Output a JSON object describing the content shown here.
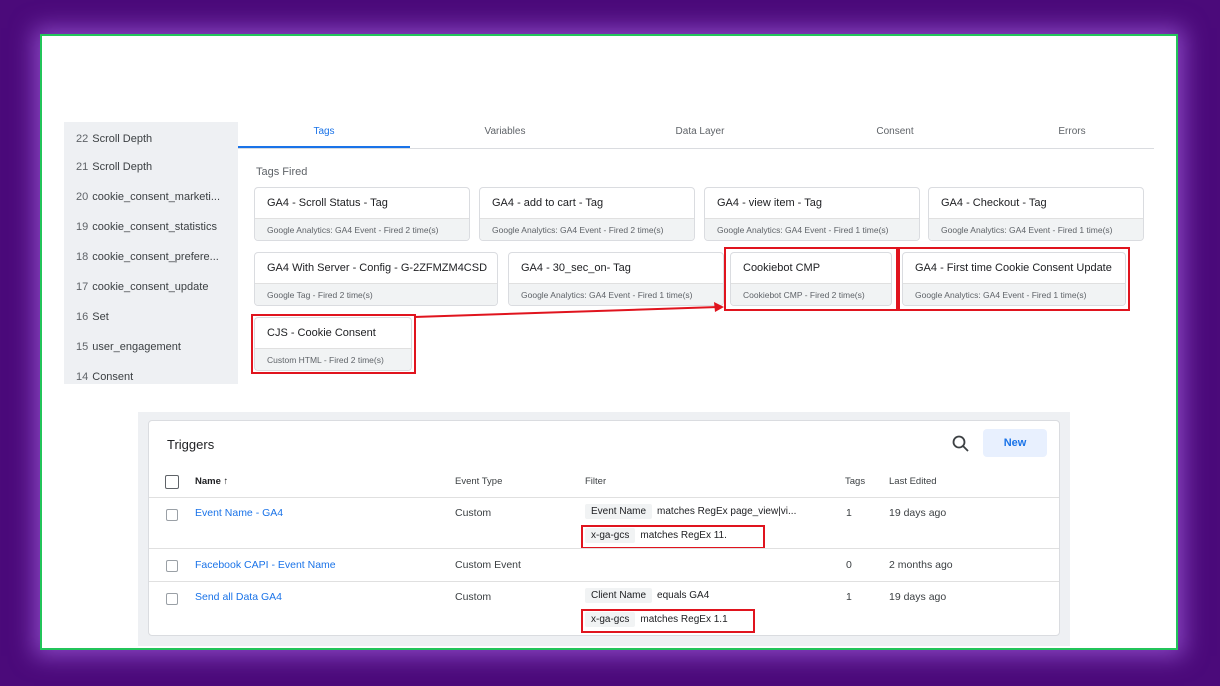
{
  "sidebar": {
    "items": [
      {
        "num": "22",
        "label": "Scroll Depth"
      },
      {
        "num": "21",
        "label": "Scroll Depth"
      },
      {
        "num": "20",
        "label": "cookie_consent_marketi..."
      },
      {
        "num": "19",
        "label": "cookie_consent_statistics"
      },
      {
        "num": "18",
        "label": "cookie_consent_prefere..."
      },
      {
        "num": "17",
        "label": "cookie_consent_update"
      },
      {
        "num": "16",
        "label": "Set"
      },
      {
        "num": "15",
        "label": "user_engagement"
      },
      {
        "num": "14",
        "label": "Consent"
      }
    ]
  },
  "tabs": [
    "Tags",
    "Variables",
    "Data Layer",
    "Consent",
    "Errors"
  ],
  "tags_fired_label": "Tags Fired",
  "tags": [
    {
      "name": "GA4 - Scroll Status - Tag",
      "desc": "Google Analytics: GA4 Event - Fired 2 time(s)"
    },
    {
      "name": "GA4 - add to cart - Tag",
      "desc": "Google Analytics: GA4 Event - Fired 2 time(s)"
    },
    {
      "name": "GA4 - view item - Tag",
      "desc": "Google Analytics: GA4 Event - Fired 1 time(s)"
    },
    {
      "name": "GA4 - Checkout - Tag",
      "desc": "Google Analytics: GA4 Event - Fired 1 time(s)"
    },
    {
      "name": "GA4 With Server - Config - G-2ZFMZM4CSD",
      "desc": "Google Tag - Fired 2 time(s)"
    },
    {
      "name": "GA4 - 30_sec_on- Tag",
      "desc": "Google Analytics: GA4 Event - Fired 1 time(s)"
    },
    {
      "name": "Cookiebot CMP",
      "desc": "Cookiebot CMP - Fired 2 time(s)"
    },
    {
      "name": "GA4 - First time Cookie Consent Update",
      "desc": "Google Analytics: GA4 Event - Fired 1 time(s)"
    },
    {
      "name": "CJS - Cookie Consent",
      "desc": "Custom HTML - Fired 2 time(s)"
    }
  ],
  "highlight_color": "#e0141e",
  "triggers": {
    "title": "Triggers",
    "new_label": "New",
    "headers": {
      "name": "Name ↑",
      "event_type": "Event Type",
      "filter": "Filter",
      "tags": "Tags",
      "last_edited": "Last Edited"
    },
    "rows": [
      {
        "name": "Event Name - GA4",
        "event_type": "Custom",
        "filters": [
          {
            "chip": "Event Name",
            "text": "matches RegEx page_view|vi..."
          },
          {
            "chip": "x-ga-gcs",
            "text": "matches RegEx 11."
          }
        ],
        "tags": "1",
        "last_edited": "19 days ago"
      },
      {
        "name": "Facebook CAPI - Event Name",
        "event_type": "Custom Event",
        "filters": [],
        "tags": "0",
        "last_edited": "2 months ago"
      },
      {
        "name": "Send all Data GA4",
        "event_type": "Custom",
        "filters": [
          {
            "chip": "Client Name",
            "text": "equals GA4"
          },
          {
            "chip": "x-ga-gcs",
            "text": "matches RegEx 1.1"
          }
        ],
        "tags": "1",
        "last_edited": "19 days ago"
      }
    ]
  }
}
